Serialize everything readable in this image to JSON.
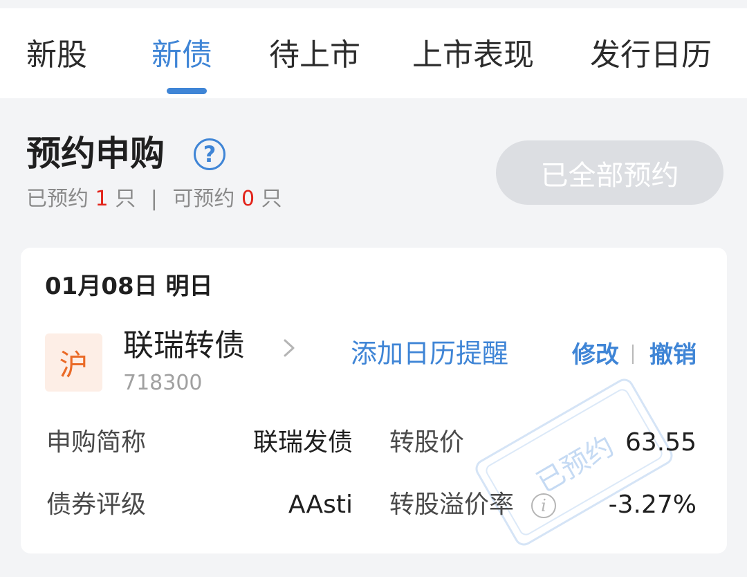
{
  "tabs": [
    {
      "label": "新股"
    },
    {
      "label": "新债"
    },
    {
      "label": "待上市"
    },
    {
      "label": "上市表现"
    },
    {
      "label": "发行日历"
    }
  ],
  "active_tab": "新债",
  "section": {
    "title": "预约申购",
    "help_icon": "help-circle-icon",
    "summary": {
      "reserved_prefix": "已预约",
      "reserved_count": "1",
      "reserved_unit": "只",
      "separator": "|",
      "available_prefix": "可预约",
      "available_count": "0",
      "available_unit": "只"
    },
    "reserve_all_button": "已全部预约"
  },
  "card": {
    "date": "01月08日 明日",
    "market_badge": "沪",
    "bond_name": "联瑞转债",
    "bond_code": "718300",
    "add_reminder": "添加日历提醒",
    "modify": "修改",
    "cancel": "撤销",
    "fields": {
      "subscribe_abbr_label": "申购简称",
      "subscribe_abbr_value": "联瑞发债",
      "conversion_price_label": "转股价",
      "conversion_price_value": "63.55",
      "rating_label": "债券评级",
      "rating_value": "AAsti",
      "premium_rate_label": "转股溢价率",
      "premium_rate_value": "-3.27%"
    },
    "stamp": "已预约"
  },
  "colors": {
    "accent": "#3f85d6",
    "red": "#e2231a",
    "badge_bg": "#fdeee6",
    "badge_fg": "#ea6a27",
    "disabled_button": "#dcdee2"
  }
}
